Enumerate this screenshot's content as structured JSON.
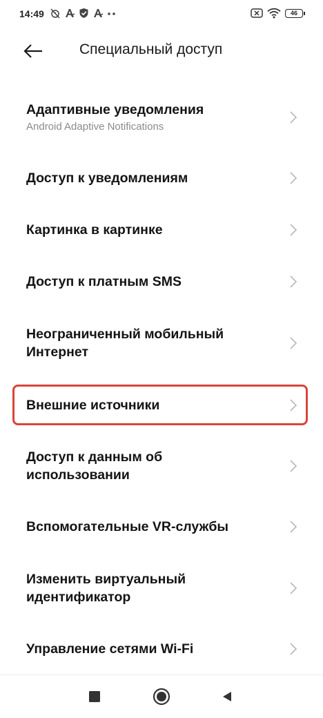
{
  "status_bar": {
    "time": "14:49",
    "battery_level": "46",
    "left_icons": [
      "alarm-off-icon",
      "a-icon",
      "shield-icon",
      "a-icon",
      "dots-icon"
    ],
    "right_icons": [
      "sim-off-icon",
      "wifi-icon",
      "battery-icon"
    ]
  },
  "header": {
    "title": "Специальный доступ",
    "back_icon": "arrow-left-icon"
  },
  "items": [
    {
      "title": "Адаптивные уведомления",
      "subtitle": "Android Adaptive Notifications"
    },
    {
      "title": "Доступ к уведомлениям"
    },
    {
      "title": "Картинка в картинке"
    },
    {
      "title": "Доступ к платным SMS"
    },
    {
      "title": "Неограниченный мобильный Интернет"
    },
    {
      "title": "Внешние источники",
      "highlighted": true
    },
    {
      "title": "Доступ к данным об использовании"
    },
    {
      "title": "Вспомогательные VR-службы"
    },
    {
      "title": "Изменить виртуальный идентификатор"
    },
    {
      "title": "Управление сетями Wi-Fi"
    }
  ],
  "colors": {
    "highlight_border": "#d9453a",
    "chevron": "#b8b8b8",
    "subtitle": "#8a8a8a"
  },
  "nav_bar": {
    "buttons": [
      "recents-square-icon",
      "home-circle-icon",
      "back-triangle-icon"
    ]
  }
}
